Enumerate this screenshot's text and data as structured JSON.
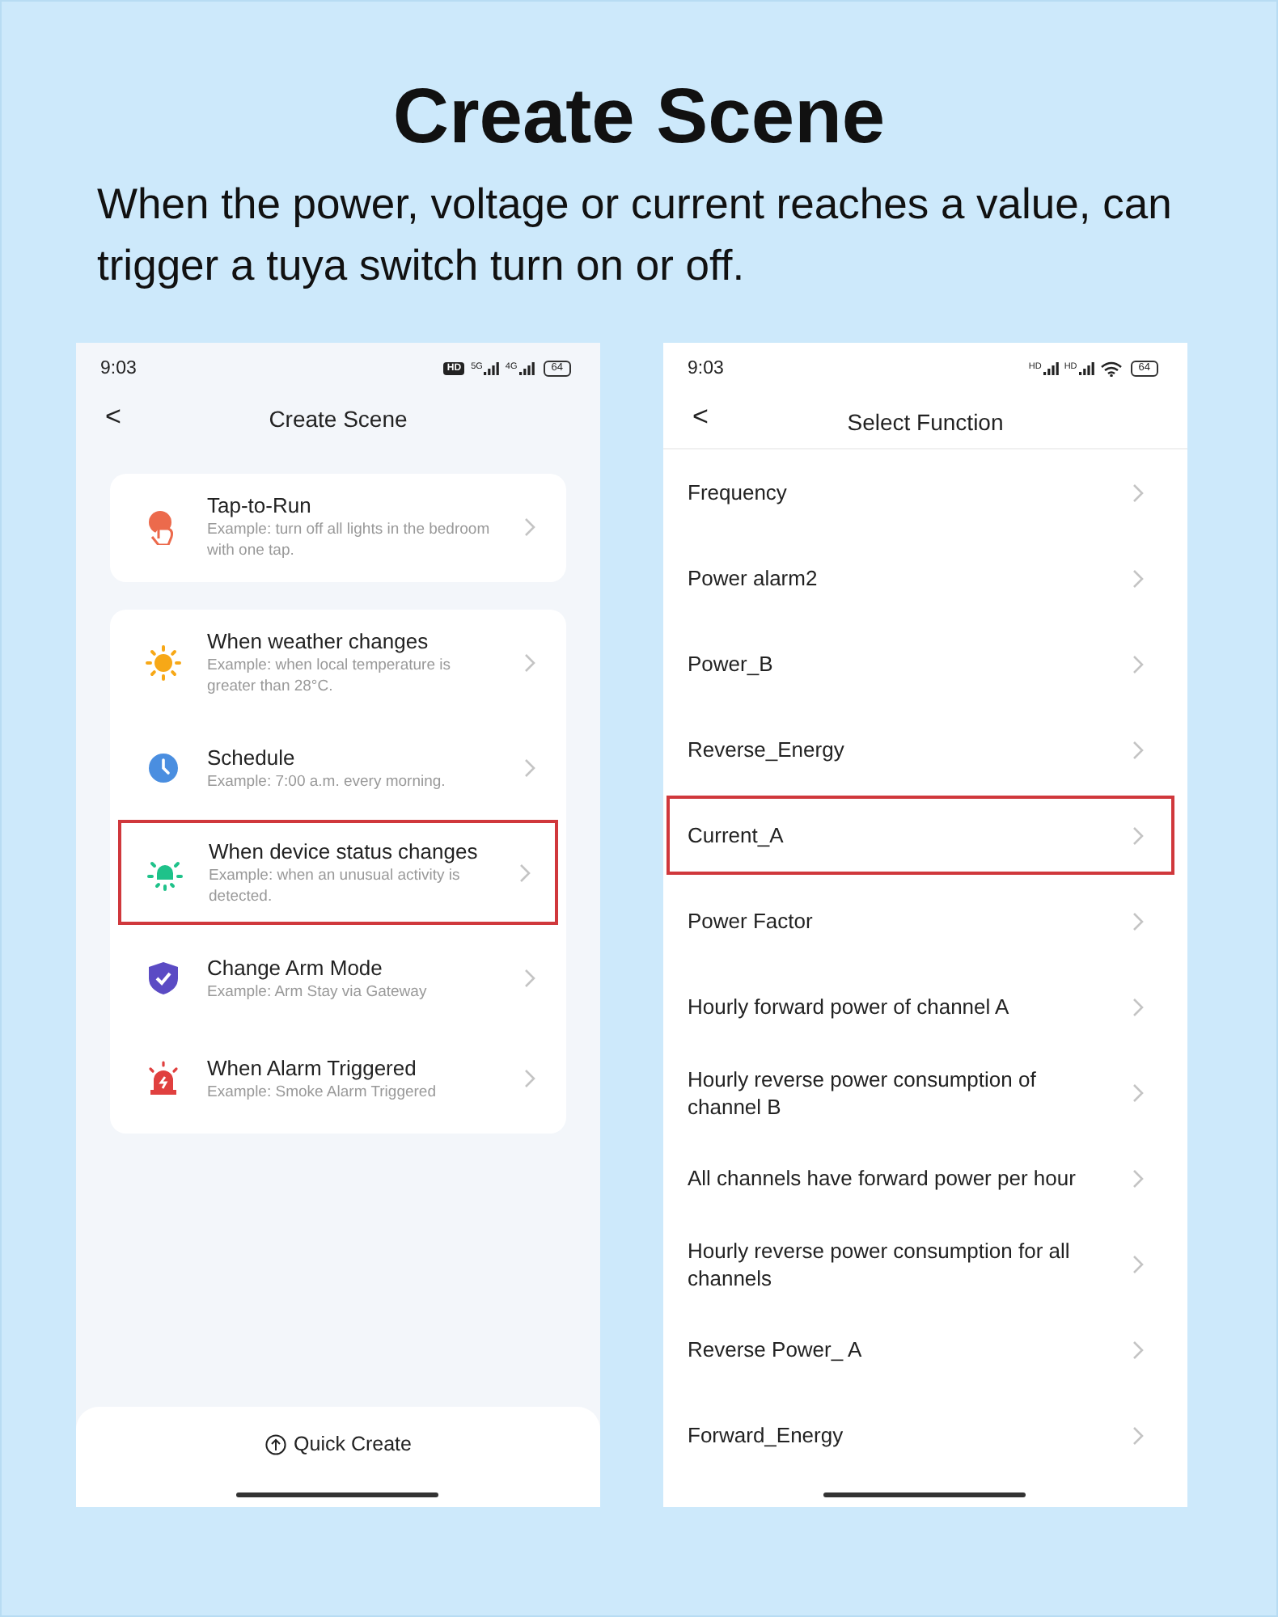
{
  "headline": {
    "title": "Create Scene",
    "description": "When the power, voltage or current reaches a value, can trigger a tuya switch turn on or off."
  },
  "left_screen": {
    "status_bar": {
      "time": "9:03",
      "badge": "HD",
      "signals": [
        "5G",
        "4G"
      ],
      "battery": "64"
    },
    "header": {
      "back": "<",
      "title": "Create Scene"
    },
    "cards": [
      {
        "items": [
          {
            "kind": "tap",
            "title": "Tap-to-Run",
            "example": "Example: turn off all lights in the bedroom with one tap.",
            "highlighted": false
          }
        ]
      },
      {
        "items": [
          {
            "kind": "weather",
            "title": "When weather changes",
            "example": "Example: when local temperature is greater than 28°C.",
            "highlighted": false
          },
          {
            "kind": "schedule",
            "title": "Schedule",
            "example": "Example: 7:00 a.m. every morning.",
            "highlighted": false
          },
          {
            "kind": "device",
            "title": "When device status changes",
            "example": "Example: when an unusual activity is detected.",
            "highlighted": true
          },
          {
            "kind": "arm",
            "title": "Change Arm Mode",
            "example": "Example: Arm Stay via Gateway",
            "highlighted": false
          },
          {
            "kind": "alarm",
            "title": "When Alarm Triggered",
            "example": "Example: Smoke Alarm Triggered",
            "highlighted": false
          }
        ]
      }
    ],
    "bottom_button": "Quick Create"
  },
  "right_screen": {
    "status_bar": {
      "time": "9:03",
      "signals": [
        "HD",
        "HD"
      ],
      "battery": "64"
    },
    "header": {
      "back": "<",
      "title": "Select Function"
    },
    "functions": [
      {
        "label": "Frequency",
        "highlighted": false
      },
      {
        "label": "Power alarm2",
        "highlighted": false
      },
      {
        "label": "Power_B",
        "highlighted": false
      },
      {
        "label": "Reverse_Energy",
        "highlighted": false
      },
      {
        "label": "Current_A",
        "highlighted": true
      },
      {
        "label": "Power Factor",
        "highlighted": false
      },
      {
        "label": "Hourly forward power of channel A",
        "highlighted": false
      },
      {
        "label": "Hourly reverse power consumption of channel B",
        "highlighted": false
      },
      {
        "label": "All channels have forward power per hour",
        "highlighted": false
      },
      {
        "label": "Hourly reverse power consumption for all channels",
        "highlighted": false
      },
      {
        "label": "Reverse Power_ A",
        "highlighted": false
      },
      {
        "label": "Forward_Energy",
        "highlighted": false
      }
    ]
  }
}
